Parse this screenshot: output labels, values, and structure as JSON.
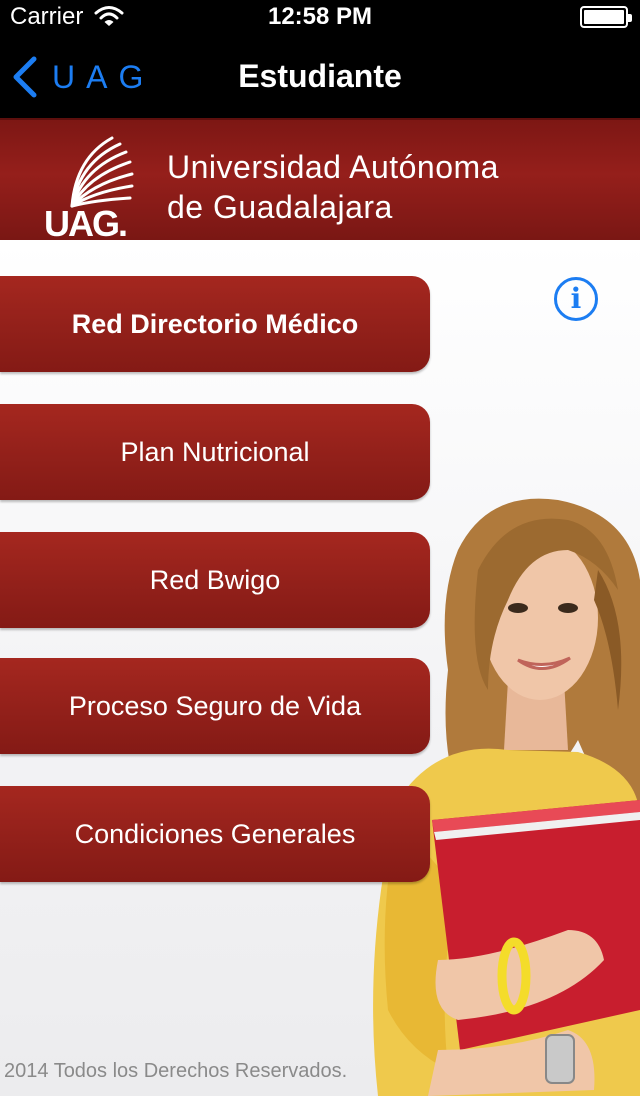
{
  "status_bar": {
    "carrier": "Carrier",
    "time": "12:58 PM",
    "icons": [
      "wifi-icon",
      "battery-icon"
    ]
  },
  "nav_bar": {
    "back_label": "UAG",
    "title": "Estudiante",
    "accent_color": "#1c7df2"
  },
  "banner": {
    "logo_text": "UAG.",
    "university_line1": "Universidad Autónoma",
    "university_line2": "de Guadalajara",
    "brand_color": "#8a1c17"
  },
  "info_button": {
    "icon": "info-icon",
    "label": "i"
  },
  "menu": [
    {
      "label": "Red Directorio Médico"
    },
    {
      "label": "Plan Nutricional"
    },
    {
      "label": "Red Bwigo"
    },
    {
      "label": "Proceso Seguro de Vida"
    },
    {
      "label": "Condiciones Generales"
    }
  ],
  "footer": {
    "text": "2014 Todos los Derechos Reservados."
  }
}
